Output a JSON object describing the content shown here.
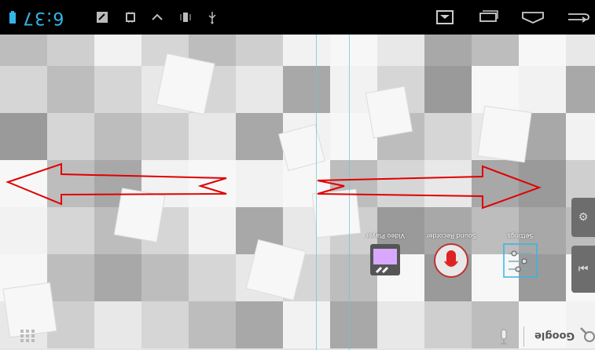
{
  "status_bar": {
    "clock": "6:37",
    "background": "#000000",
    "accent": "#33b5e5",
    "icons": [
      "battery-icon",
      "notification-icon",
      "debug-icon",
      "chevron-up-icon",
      "vibrate-icon",
      "usb-icon",
      "screenshot-icon",
      "recent-apps-icon",
      "home-icon",
      "back-icon"
    ]
  },
  "dock": {
    "apps": [
      {
        "name": "Video Player",
        "icon": "video-player-icon"
      },
      {
        "name": "Sound Recorder",
        "icon": "microphone-icon"
      },
      {
        "name": "Settings",
        "icon": "settings-icon"
      }
    ]
  },
  "search": {
    "label": "Google"
  },
  "colors": {
    "arrow": "#e00000",
    "panel_line": "#6fc4d9",
    "wallpaper_light": "#f2f2f2",
    "wallpaper_dark": "#9a9a9a"
  }
}
